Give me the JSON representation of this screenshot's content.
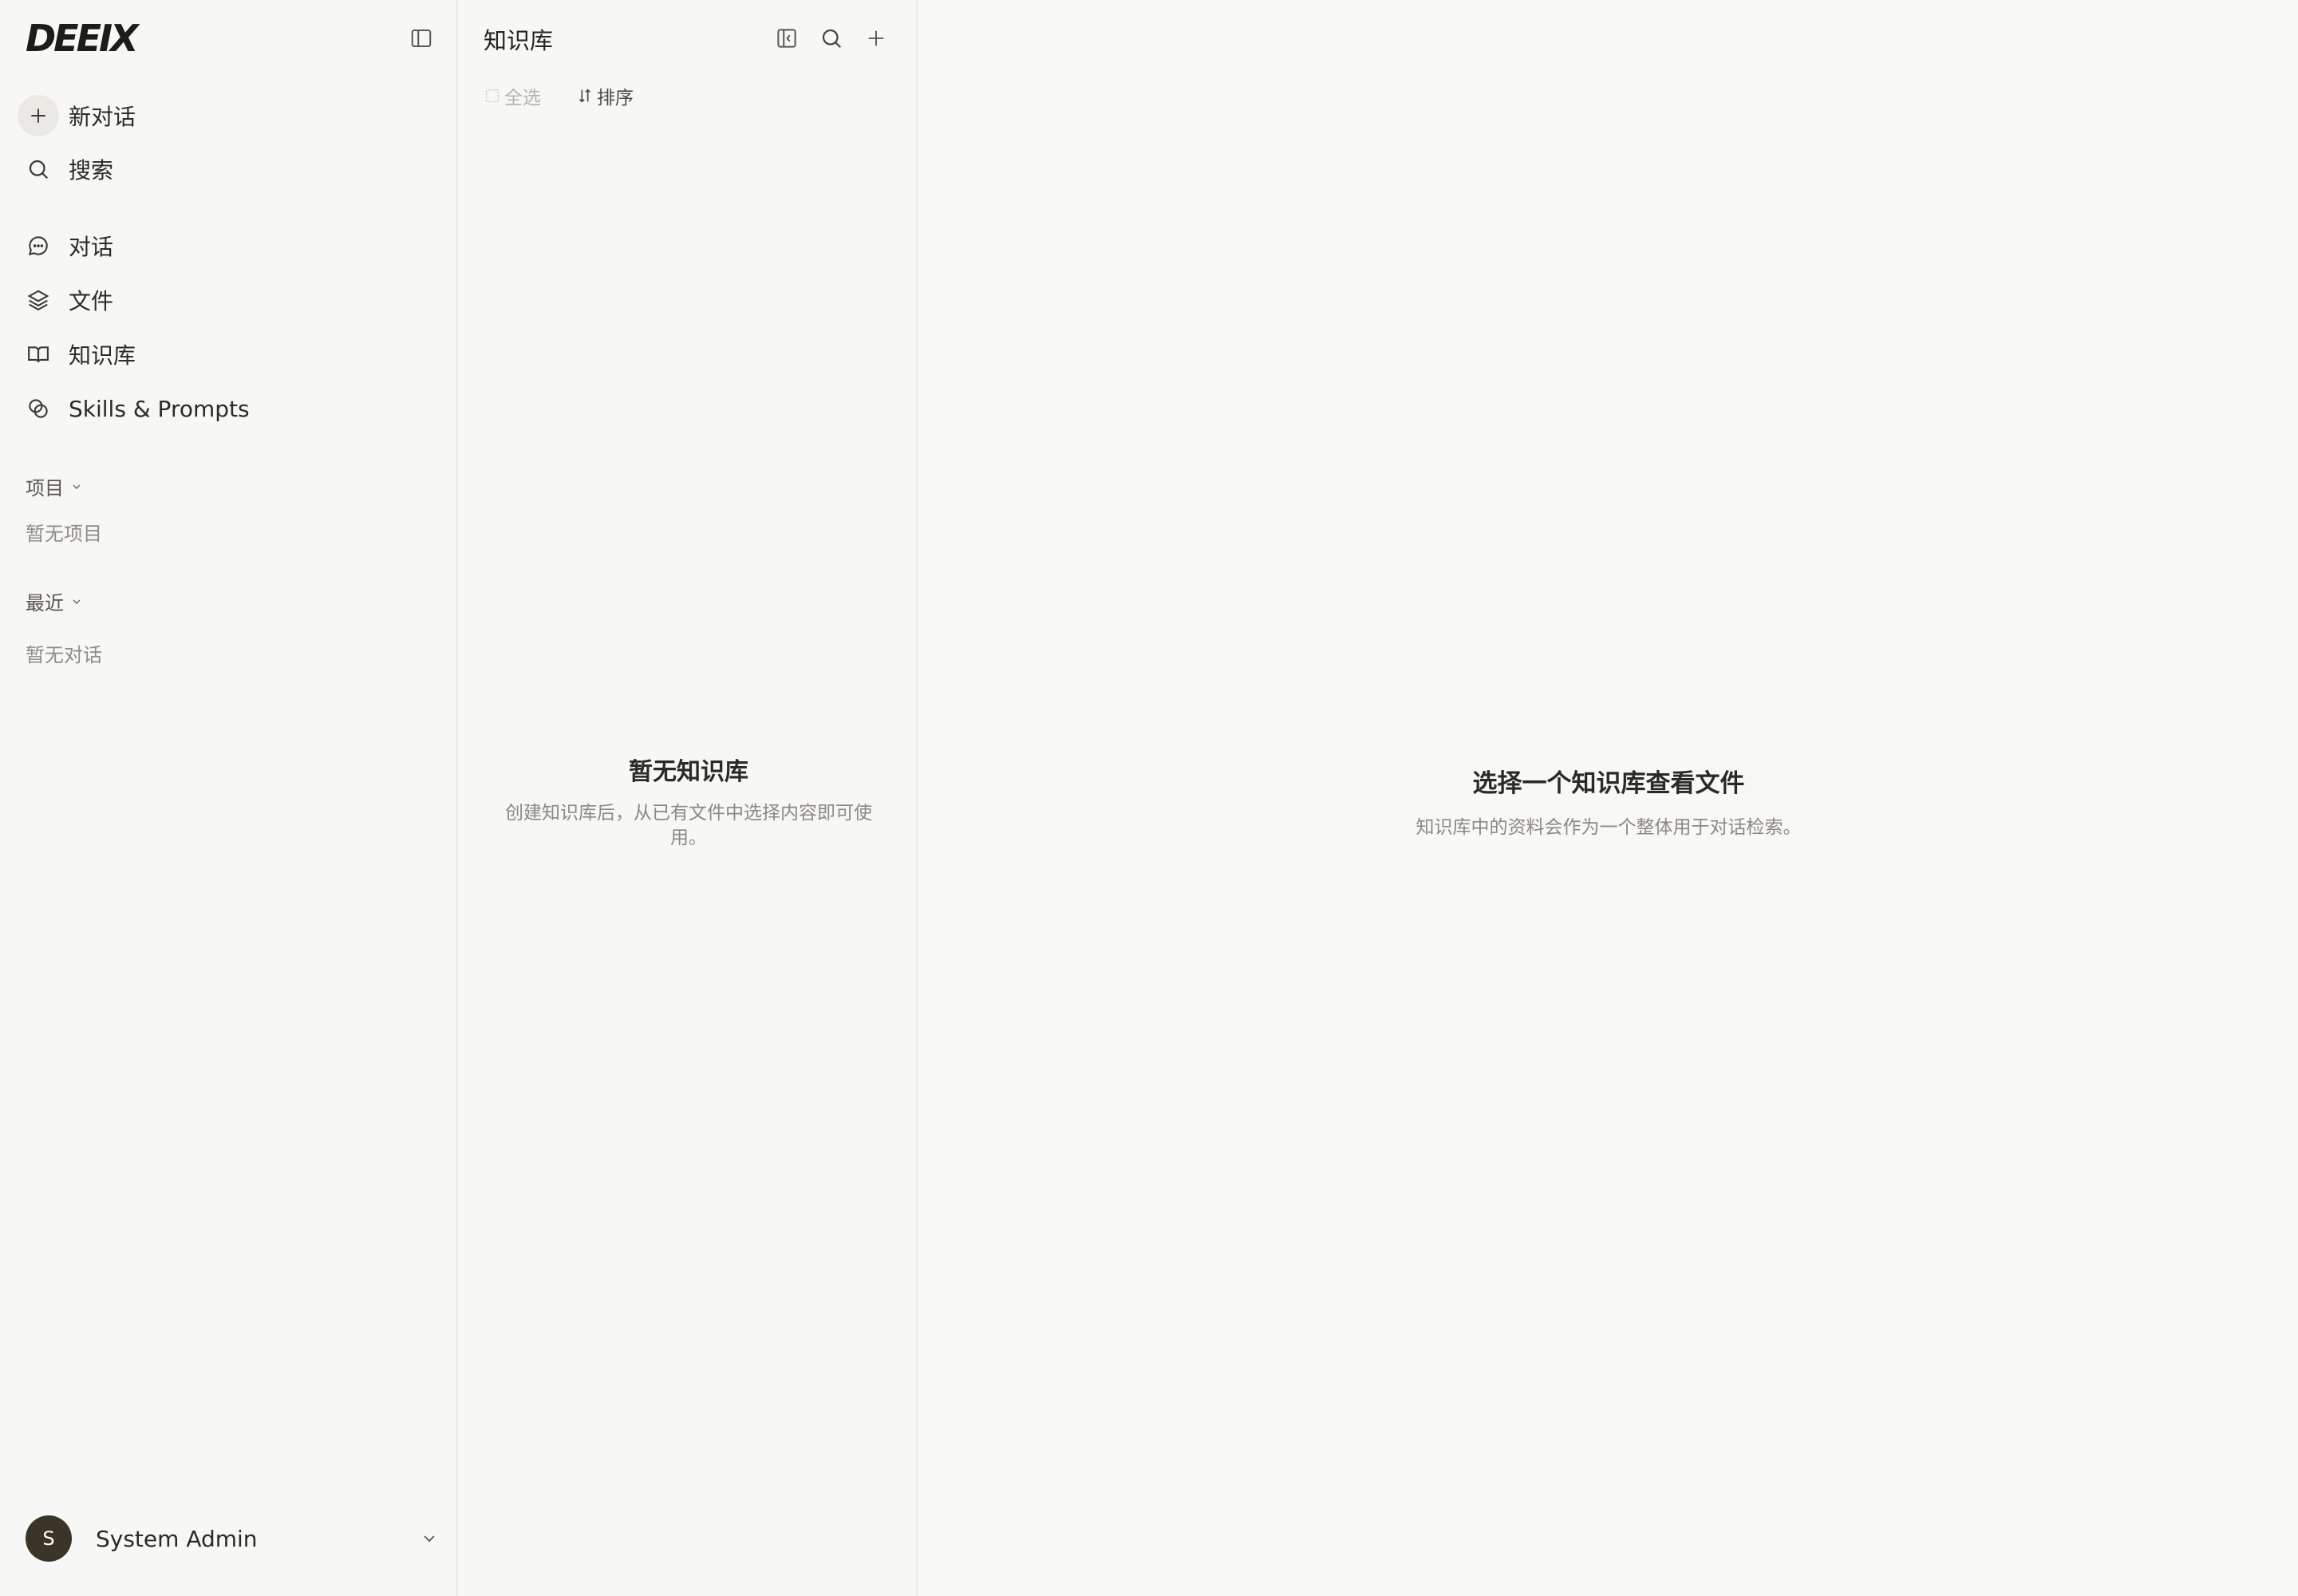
{
  "brand": {
    "logo_text": "DEEIX"
  },
  "sidebar": {
    "new_chat_label": "新对话",
    "search_label": "搜索",
    "nav": [
      {
        "label": "对话",
        "icon": "chat-bubble-icon"
      },
      {
        "label": "文件",
        "icon": "layers-icon"
      },
      {
        "label": "知识库",
        "icon": "book-open-icon"
      },
      {
        "label": "Skills & Prompts",
        "icon": "skills-icon"
      }
    ],
    "projects": {
      "heading": "项目",
      "empty_text": "暂无项目"
    },
    "recent": {
      "heading": "最近",
      "empty_text": "暂无对话"
    },
    "user": {
      "avatar_initial": "S",
      "name": "System Admin"
    }
  },
  "knowledge_panel": {
    "title": "知识库",
    "select_all_label": "全选",
    "sort_label": "排序",
    "empty_title": "暂无知识库",
    "empty_desc": "创建知识库后，从已有文件中选择内容即可使用。"
  },
  "main": {
    "empty_title": "选择一个知识库查看文件",
    "empty_desc": "知识库中的资料会作为一个整体用于对话检索。"
  },
  "colors": {
    "background": "#f8f8f6",
    "border": "#e7e7e3",
    "avatar_bg": "#3a3527",
    "muted_text": "#8a8983"
  }
}
